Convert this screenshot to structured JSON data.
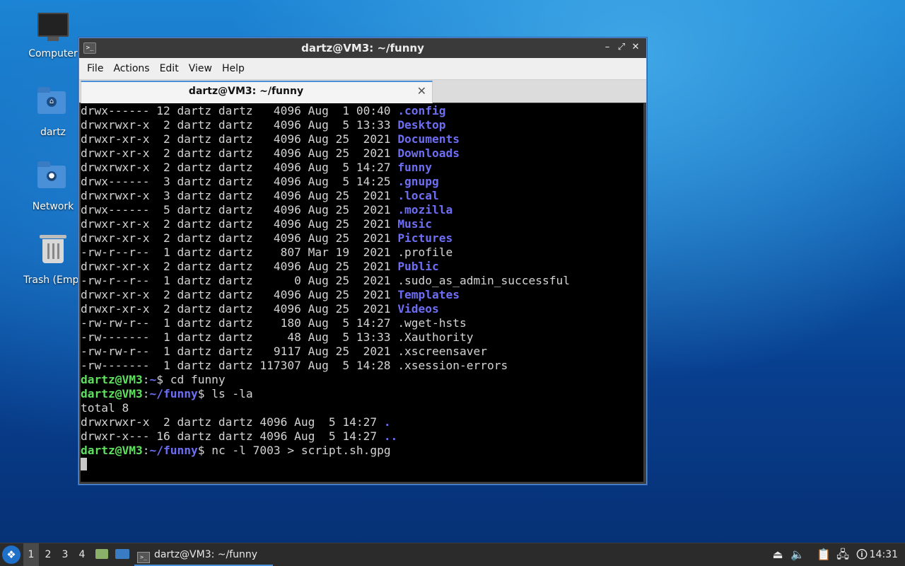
{
  "desktop": {
    "icons": [
      {
        "label": "Computer",
        "icon": "computer-icon"
      },
      {
        "label": "dartz",
        "icon": "home-folder-icon"
      },
      {
        "label": "Network",
        "icon": "network-folder-icon"
      },
      {
        "label": "Trash (Empt",
        "icon": "trash-icon"
      }
    ]
  },
  "window": {
    "title": "dartz@VM3: ~/funny",
    "controls": {
      "minimize": "–",
      "maximize": "⤢",
      "close": "✕"
    },
    "menu": [
      "File",
      "Actions",
      "Edit",
      "View",
      "Help"
    ],
    "tab": {
      "label": "dartz@VM3: ~/funny",
      "close": "✕"
    }
  },
  "terminal": {
    "listing": [
      {
        "meta": "drwx------ 12 dartz dartz   4096 Aug  1 00:40 ",
        "name": ".config",
        "dir": true
      },
      {
        "meta": "drwxrwxr-x  2 dartz dartz   4096 Aug  5 13:33 ",
        "name": "Desktop",
        "dir": true
      },
      {
        "meta": "drwxr-xr-x  2 dartz dartz   4096 Aug 25  2021 ",
        "name": "Documents",
        "dir": true
      },
      {
        "meta": "drwxr-xr-x  2 dartz dartz   4096 Aug 25  2021 ",
        "name": "Downloads",
        "dir": true
      },
      {
        "meta": "drwxrwxr-x  2 dartz dartz   4096 Aug  5 14:27 ",
        "name": "funny",
        "dir": true
      },
      {
        "meta": "drwx------  3 dartz dartz   4096 Aug  5 14:25 ",
        "name": ".gnupg",
        "dir": true
      },
      {
        "meta": "drwxrwxr-x  3 dartz dartz   4096 Aug 25  2021 ",
        "name": ".local",
        "dir": true
      },
      {
        "meta": "drwx------  5 dartz dartz   4096 Aug 25  2021 ",
        "name": ".mozilla",
        "dir": true
      },
      {
        "meta": "drwxr-xr-x  2 dartz dartz   4096 Aug 25  2021 ",
        "name": "Music",
        "dir": true
      },
      {
        "meta": "drwxr-xr-x  2 dartz dartz   4096 Aug 25  2021 ",
        "name": "Pictures",
        "dir": true
      },
      {
        "meta": "-rw-r--r--  1 dartz dartz    807 Mar 19  2021 ",
        "name": ".profile",
        "dir": false
      },
      {
        "meta": "drwxr-xr-x  2 dartz dartz   4096 Aug 25  2021 ",
        "name": "Public",
        "dir": true
      },
      {
        "meta": "-rw-r--r--  1 dartz dartz      0 Aug 25  2021 ",
        "name": ".sudo_as_admin_successful",
        "dir": false
      },
      {
        "meta": "drwxr-xr-x  2 dartz dartz   4096 Aug 25  2021 ",
        "name": "Templates",
        "dir": true
      },
      {
        "meta": "drwxr-xr-x  2 dartz dartz   4096 Aug 25  2021 ",
        "name": "Videos",
        "dir": true
      },
      {
        "meta": "-rw-rw-r--  1 dartz dartz    180 Aug  5 14:27 ",
        "name": ".wget-hsts",
        "dir": false
      },
      {
        "meta": "-rw-------  1 dartz dartz     48 Aug  5 13:33 ",
        "name": ".Xauthority",
        "dir": false
      },
      {
        "meta": "-rw-rw-r--  1 dartz dartz   9117 Aug 25  2021 ",
        "name": ".xscreensaver",
        "dir": false
      },
      {
        "meta": "-rw-------  1 dartz dartz 117307 Aug  5 14:28 ",
        "name": ".xsession-errors",
        "dir": false
      }
    ],
    "cmd1": {
      "user": "dartz@VM3",
      "sep": ":",
      "path": "~",
      "cmd": "$ cd funny"
    },
    "cmd2": {
      "user": "dartz@VM3",
      "sep": ":",
      "path": "~/funny",
      "cmd": "$ ls -la"
    },
    "total": "total 8",
    "listing2": [
      {
        "meta": "drwxrwxr-x  2 dartz dartz 4096 Aug  5 14:27 ",
        "name": ".",
        "dir": true
      },
      {
        "meta": "drwxr-x--- 16 dartz dartz 4096 Aug  5 14:27 ",
        "name": "..",
        "dir": true
      }
    ],
    "cmd3": {
      "user": "dartz@VM3",
      "sep": ":",
      "path": "~/funny",
      "cmd": "$ nc -l 7003 > script.sh.gpg"
    }
  },
  "taskbar": {
    "start_icon": "start-menu-icon",
    "workspaces": [
      "1",
      "2",
      "3",
      "4"
    ],
    "active_workspace": "1",
    "task_label": "dartz@VM3: ~/funny",
    "clock": "14:31"
  }
}
